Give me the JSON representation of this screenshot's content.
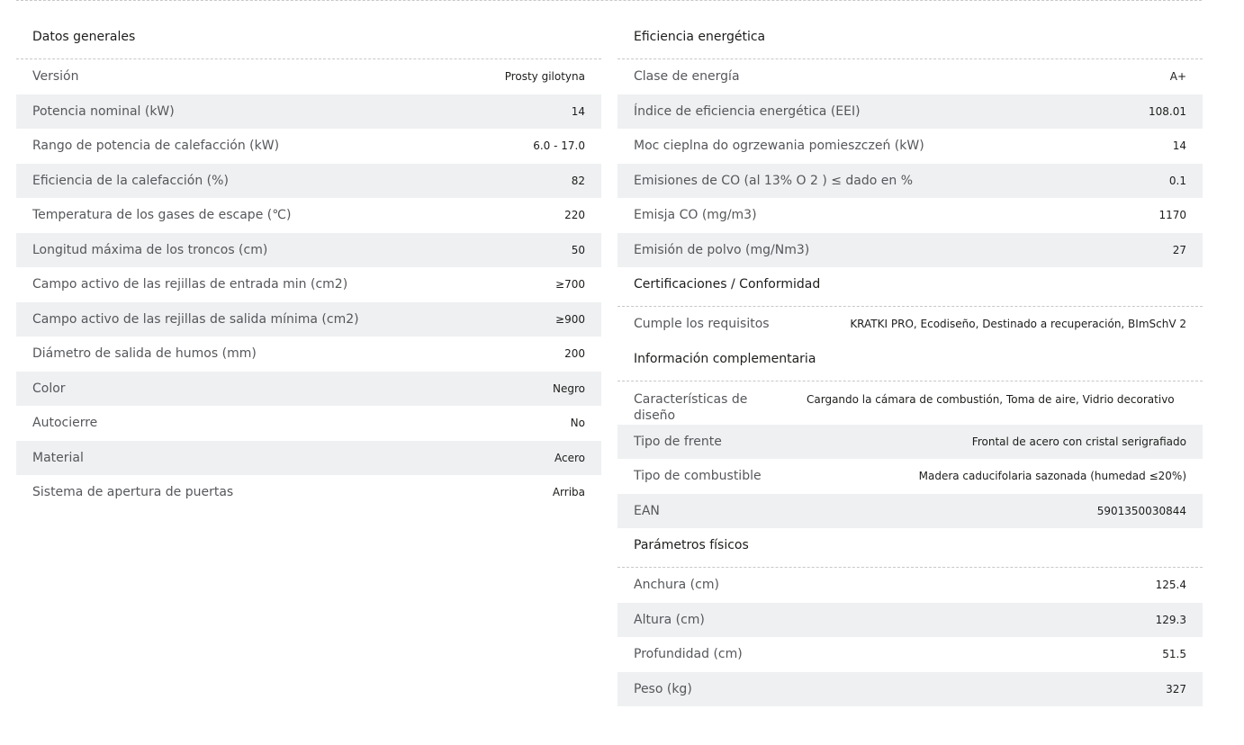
{
  "general": {
    "title": "Datos generales",
    "rows": [
      {
        "label": "Versión",
        "value": "Prosty gilotyna"
      },
      {
        "label": "Potencia nominal (kW)",
        "value": "14"
      },
      {
        "label": "Rango de potencia de calefacción (kW)",
        "value": "6.0 - 17.0"
      },
      {
        "label": "Eficiencia de la calefacción (%)",
        "value": "82"
      },
      {
        "label": "Temperatura de los gases de escape (℃)",
        "value": "220"
      },
      {
        "label": "Longitud máxima de los troncos (cm)",
        "value": "50"
      },
      {
        "label": "Campo activo de las rejillas de entrada min (cm2)",
        "value": "≥700"
      },
      {
        "label": "Campo activo de las rejillas de salida mínima (cm2)",
        "value": "≥900"
      },
      {
        "label": "Diámetro de salida de humos (mm)",
        "value": "200"
      },
      {
        "label": "Color",
        "value": "Negro"
      },
      {
        "label": "Autocierre",
        "value": "No"
      },
      {
        "label": "Material",
        "value": "Acero"
      },
      {
        "label": "Sistema de apertura de puertas",
        "value": "Arriba"
      }
    ]
  },
  "efficiency": {
    "title": "Eficiencia energética",
    "rows": [
      {
        "label": "Clase de energía",
        "value": "A+"
      },
      {
        "label": "Índice de eficiencia energética (EEI)",
        "value": "108.01"
      },
      {
        "label": "Moc cieplna do ogrzewania pomieszczeń (kW)",
        "value": "14"
      },
      {
        "label": "Emisiones de CO (al 13% O 2 ) ≤ dado en %",
        "value": "0.1"
      },
      {
        "label": "Emisja CO (mg/m3)",
        "value": "1170"
      },
      {
        "label": "Emisión de polvo (mg/Nm3)",
        "value": "27"
      }
    ]
  },
  "certifications": {
    "title": "Certificaciones / Conformidad",
    "rows": [
      {
        "label": "Cumple los requisitos",
        "value": "KRATKI PRO, Ecodiseño, Destinado a recuperación, BImSchV 2"
      }
    ]
  },
  "complementary": {
    "title": "Información complementaria",
    "rows": [
      {
        "label": "Características de diseño",
        "value": "Cargando la cámara de combustión, Toma de aire, Vidrio decorativo"
      },
      {
        "label": "Tipo de frente",
        "value": "Frontal de acero con cristal serigrafiado"
      },
      {
        "label": "Tipo de combustible",
        "value": "Madera caducifolaria sazonada (humedad ≤20%)"
      },
      {
        "label": "EAN",
        "value": "5901350030844"
      }
    ]
  },
  "physical": {
    "title": "Parámetros físicos",
    "rows": [
      {
        "label": "Anchura (cm)",
        "value": "125.4"
      },
      {
        "label": "Altura (cm)",
        "value": "129.3"
      },
      {
        "label": "Profundidad (cm)",
        "value": "51.5"
      },
      {
        "label": "Peso (kg)",
        "value": "327"
      }
    ]
  }
}
